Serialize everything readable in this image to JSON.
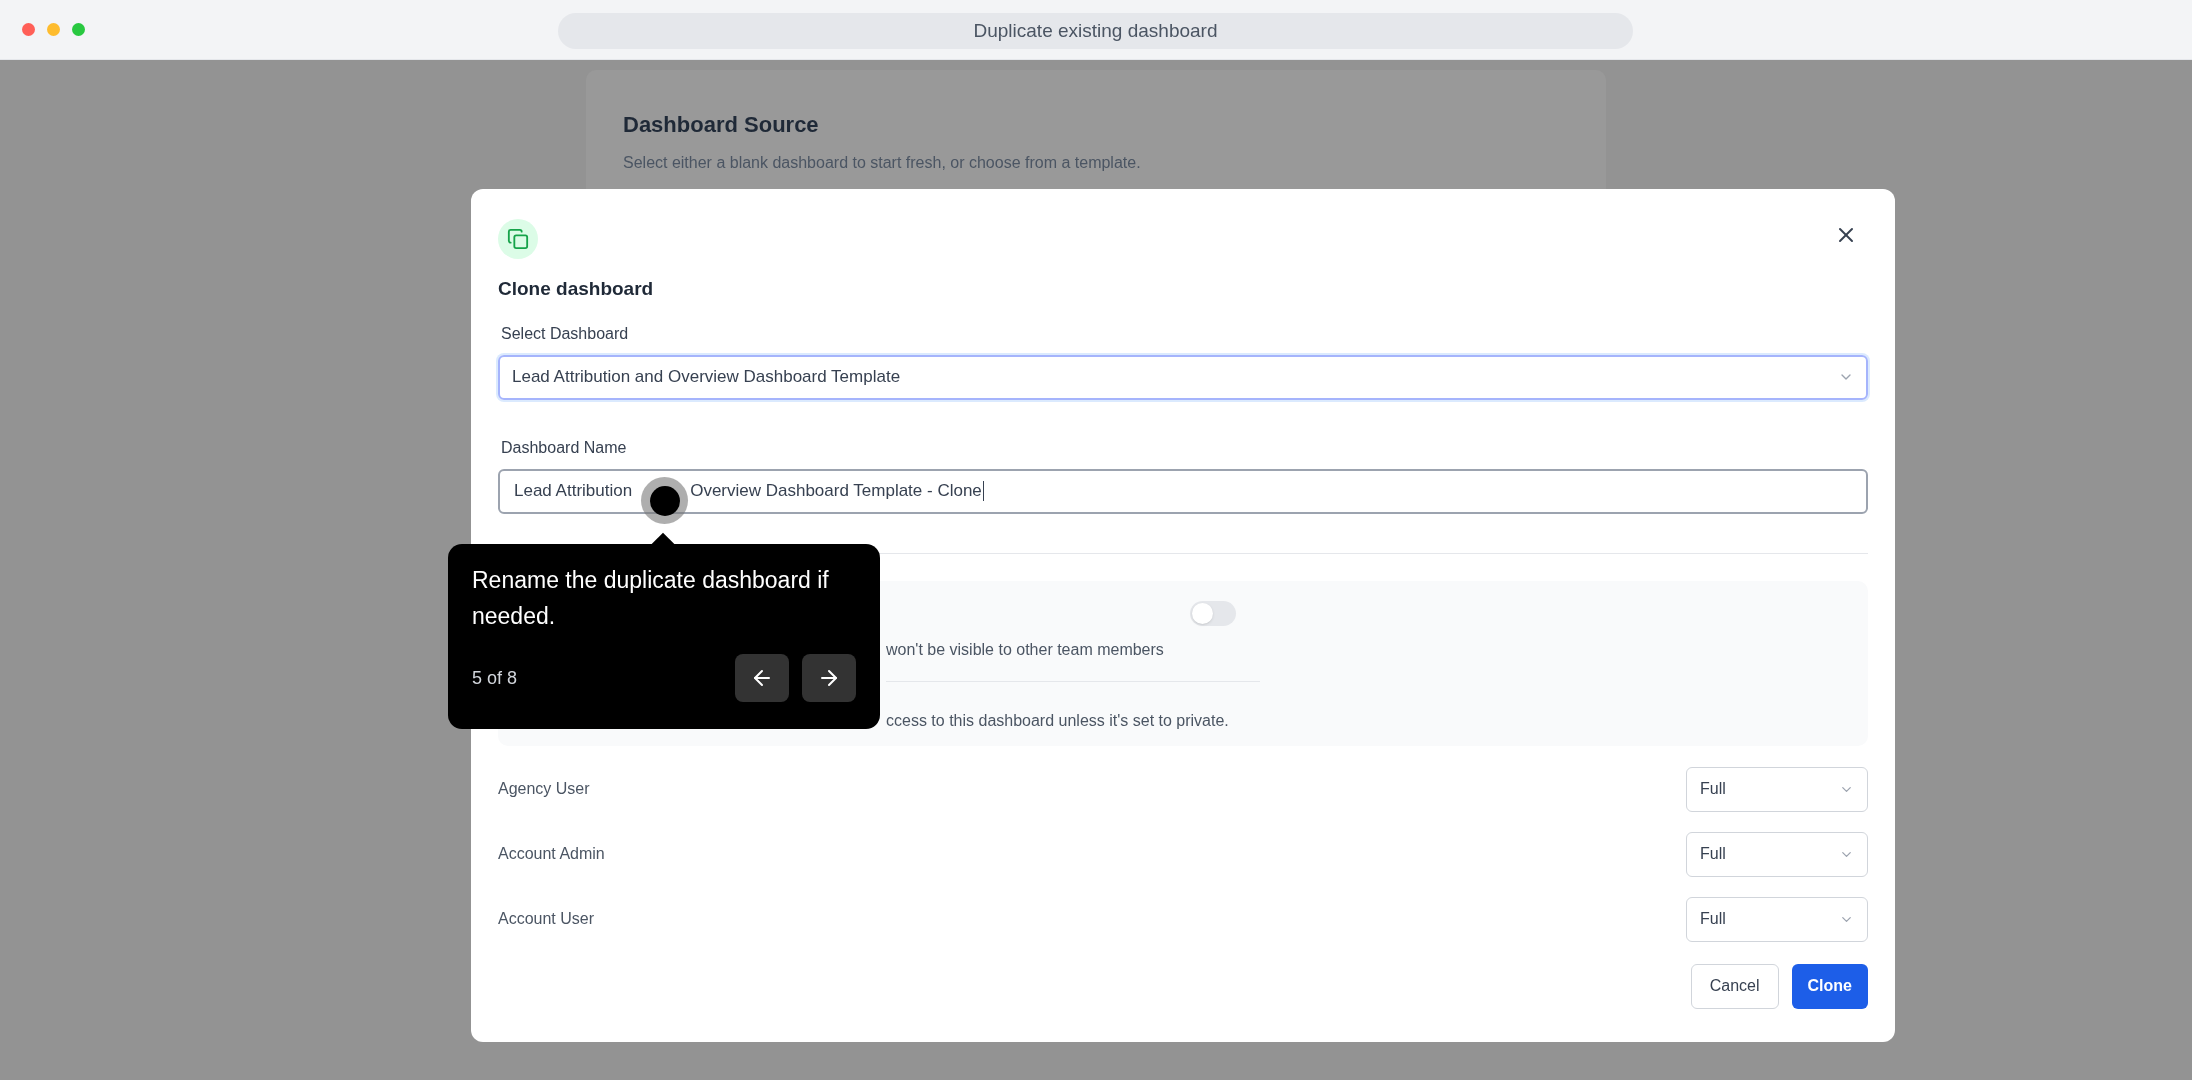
{
  "window": {
    "title": "Duplicate existing dashboard"
  },
  "background_card": {
    "title": "Dashboard Source",
    "subtitle": "Select either a blank dashboard to start fresh, or choose from a template."
  },
  "modal": {
    "title": "Clone dashboard",
    "select_dashboard": {
      "label": "Select Dashboard",
      "value": "Lead Attribution and Overview Dashboard Template"
    },
    "dashboard_name": {
      "label": "Dashboard Name",
      "value_parts": [
        "Lead Attribution",
        "Overview Dashboard Template - Clone"
      ]
    },
    "private_section": {
      "description": "won't be visible to other team members",
      "toggle_on": false,
      "note": "ccess to this dashboard unless it's set to private."
    },
    "permissions": [
      {
        "role": "Agency User",
        "access": "Full"
      },
      {
        "role": "Account Admin",
        "access": "Full"
      },
      {
        "role": "Account User",
        "access": "Full"
      }
    ],
    "buttons": [
      {
        "label": "Cancel",
        "kind": "secondary"
      },
      {
        "label": "Clone",
        "kind": "primary"
      }
    ]
  },
  "tooltip": {
    "text": "Rename the duplicate dashboard if needed.",
    "step": "5 of 8"
  }
}
